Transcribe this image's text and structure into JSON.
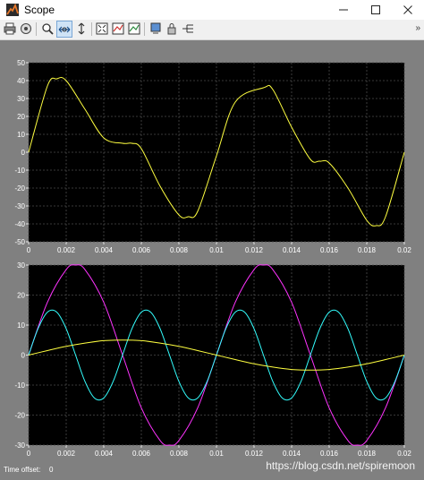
{
  "window": {
    "title": "Scope",
    "controls": [
      "minimize",
      "maximize",
      "close"
    ]
  },
  "toolbar": {
    "buttons": [
      {
        "name": "print-icon"
      },
      {
        "name": "parameters-icon"
      },
      {
        "name": "zoom-icon"
      },
      {
        "name": "zoom-x-icon"
      },
      {
        "name": "zoom-y-icon"
      },
      {
        "name": "autoscale-icon"
      },
      {
        "name": "save-axes-settings-icon"
      },
      {
        "name": "restore-axes-settings-icon"
      },
      {
        "name": "floating-scope-icon"
      },
      {
        "name": "lock-axes-icon"
      },
      {
        "name": "signal-selector-icon"
      }
    ],
    "active_button": "zoom-x-icon"
  },
  "colors": {
    "background": "#808080",
    "axes_bg": "#000000",
    "grid": "#4a4a4a",
    "tick_text": "#ffffff",
    "yellow": "#ffff40",
    "magenta": "#ff33ff",
    "cyan": "#33ffff"
  },
  "chart_data": [
    {
      "type": "line",
      "title": "",
      "xlim": [
        0,
        0.02
      ],
      "ylim": [
        -50,
        50
      ],
      "x_ticks": [
        "0",
        "0.002",
        "0.004",
        "0.006",
        "0.008",
        "0.01",
        "0.012",
        "0.014",
        "0.016",
        "0.018",
        "0.02"
      ],
      "y_ticks": [
        "50",
        "40",
        "30",
        "20",
        "10",
        "0",
        "-10",
        "-20",
        "-30",
        "-40",
        "-50"
      ],
      "grid": true,
      "series": [
        {
          "color": "#ffff40",
          "x": [
            0,
            0.001,
            0.0015,
            0.002,
            0.003,
            0.004,
            0.005,
            0.0055,
            0.006,
            0.007,
            0.008,
            0.0085,
            0.009,
            0.01,
            0.011,
            0.0125,
            0.013,
            0.014,
            0.015,
            0.0155,
            0.016,
            0.017,
            0.018,
            0.0185,
            0.019,
            0.02
          ],
          "y": [
            0,
            37,
            41,
            40,
            24,
            8,
            5,
            5,
            2,
            -19,
            -35,
            -36,
            -33,
            -2,
            28,
            36,
            35,
            14,
            -4,
            -5,
            -6,
            -20,
            -38,
            -41,
            -36,
            0
          ]
        }
      ]
    },
    {
      "type": "line",
      "title": "",
      "xlim": [
        0,
        0.02
      ],
      "ylim": [
        -30,
        30
      ],
      "x_ticks": [
        "0",
        "0.002",
        "0.004",
        "0.006",
        "0.008",
        "0.01",
        "0.012",
        "0.014",
        "0.016",
        "0.018",
        "0.02"
      ],
      "y_ticks": [
        "30",
        "20",
        "10",
        "0",
        "-10",
        "-20",
        "-30"
      ],
      "grid": true,
      "series": [
        {
          "color": "#ff33ff",
          "x": [
            0,
            0.001,
            0.002,
            0.0025,
            0.003,
            0.004,
            0.005,
            0.006,
            0.007,
            0.0075,
            0.008,
            0.009,
            0.01,
            0.011,
            0.012,
            0.0125,
            0.013,
            0.014,
            0.015,
            0.016,
            0.017,
            0.0175,
            0.018,
            0.019,
            0.02
          ],
          "y": [
            0,
            17.6,
            28.5,
            30,
            28.5,
            17.6,
            0,
            -17.6,
            -28.5,
            -30,
            -28.5,
            -17.6,
            0,
            17.6,
            28.5,
            30,
            28.5,
            17.6,
            0,
            -17.6,
            -28.5,
            -30,
            -28.5,
            -17.6,
            0
          ]
        },
        {
          "color": "#33ffff",
          "x": [
            0,
            0.0005,
            0.001,
            0.0015,
            0.002,
            0.0025,
            0.003,
            0.0035,
            0.004,
            0.0045,
            0.005,
            0.0055,
            0.006,
            0.0065,
            0.007,
            0.0075,
            0.008,
            0.0085,
            0.009,
            0.0095,
            0.01,
            0.0105,
            0.011,
            0.0115,
            0.012,
            0.0125,
            0.013,
            0.0135,
            0.014,
            0.0145,
            0.015,
            0.0155,
            0.016,
            0.0165,
            0.017,
            0.0175,
            0.018,
            0.0185,
            0.019,
            0.0195,
            0.02
          ],
          "y": [
            0,
            8.8,
            14.3,
            14.3,
            8.8,
            0,
            -8.8,
            -14.3,
            -14.3,
            -8.8,
            0,
            8.8,
            14.3,
            14.3,
            8.8,
            0,
            -8.8,
            -14.3,
            -14.3,
            -8.8,
            0,
            8.8,
            14.3,
            14.3,
            8.8,
            0,
            -8.8,
            -14.3,
            -14.3,
            -8.8,
            0,
            8.8,
            14.3,
            14.3,
            8.8,
            0,
            -8.8,
            -14.3,
            -14.3,
            -8.8,
            0
          ]
        },
        {
          "color": "#ffff40",
          "x": [
            0,
            0.001,
            0.002,
            0.003,
            0.004,
            0.005,
            0.006,
            0.007,
            0.008,
            0.009,
            0.01,
            0.011,
            0.012,
            0.013,
            0.014,
            0.015,
            0.016,
            0.017,
            0.018,
            0.019,
            0.02
          ],
          "y": [
            0,
            1.5,
            2.9,
            4.0,
            4.8,
            5,
            4.8,
            4.0,
            2.9,
            1.5,
            0,
            -1.5,
            -2.9,
            -4.0,
            -4.8,
            -5,
            -4.8,
            -4.0,
            -2.9,
            -1.5,
            0
          ]
        }
      ]
    }
  ],
  "status": {
    "label": "Time offset:",
    "value": "0"
  },
  "watermark": "https://blog.csdn.net/spiremoon"
}
